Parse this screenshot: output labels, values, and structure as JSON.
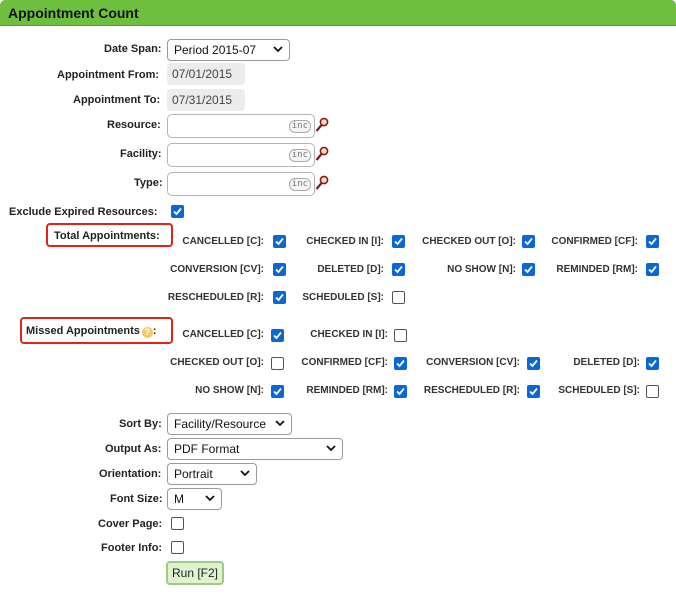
{
  "header": {
    "title": "Appointment Count"
  },
  "form": {
    "date_span": {
      "label": "Date Span:",
      "value": "Period 2015-07"
    },
    "appt_from": {
      "label": "Appointment From:",
      "value": "07/01/2015"
    },
    "appt_to": {
      "label": "Appointment To:",
      "value": "07/31/2015"
    },
    "resource": {
      "label": "Resource:",
      "value": "",
      "tag": "inc"
    },
    "facility": {
      "label": "Facility:",
      "value": "",
      "tag": "inc"
    },
    "type": {
      "label": "Type:",
      "value": "",
      "tag": "inc"
    },
    "exclude_expired": {
      "label": "Exclude Expired Resources:",
      "checked": true
    }
  },
  "total_appointments": {
    "label": "Total Appointments:",
    "options": [
      {
        "label": "CANCELLED [C]:",
        "checked": true
      },
      {
        "label": "CHECKED IN [I]:",
        "checked": true
      },
      {
        "label": "CHECKED OUT [O]:",
        "checked": true
      },
      {
        "label": "CONFIRMED [CF]:",
        "checked": true
      },
      {
        "label": "CONVERSION [CV]:",
        "checked": true
      },
      {
        "label": "DELETED [D]:",
        "checked": true
      },
      {
        "label": "NO SHOW [N]:",
        "checked": true
      },
      {
        "label": "REMINDED [RM]:",
        "checked": true
      },
      {
        "label": "RESCHEDULED [R]:",
        "checked": true
      },
      {
        "label": "SCHEDULED [S]:",
        "checked": false
      }
    ]
  },
  "missed_appointments": {
    "label": "Missed Appointments",
    "options": [
      {
        "label": "CANCELLED [C]:",
        "checked": true
      },
      {
        "label": "CHECKED IN [I]:",
        "checked": false
      },
      {
        "label": "CHECKED OUT [O]:",
        "checked": false
      },
      {
        "label": "CONFIRMED [CF]:",
        "checked": true
      },
      {
        "label": "CONVERSION [CV]:",
        "checked": true
      },
      {
        "label": "DELETED [D]:",
        "checked": true
      },
      {
        "label": "NO SHOW [N]:",
        "checked": true
      },
      {
        "label": "REMINDED [RM]:",
        "checked": true
      },
      {
        "label": "RESCHEDULED [R]:",
        "checked": true
      },
      {
        "label": "SCHEDULED [S]:",
        "checked": false
      }
    ]
  },
  "output": {
    "sort_by": {
      "label": "Sort By:",
      "value": "Facility/Resource"
    },
    "output_as": {
      "label": "Output As:",
      "value": "PDF Format"
    },
    "orientation": {
      "label": "Orientation:",
      "value": "Portrait"
    },
    "font_size": {
      "label": "Font Size:",
      "value": "M"
    },
    "cover_page": {
      "label": "Cover Page:",
      "checked": false
    },
    "footer_info": {
      "label": "Footer Info:",
      "checked": false
    },
    "run_label": "Run [F2]"
  },
  "colors": {
    "header": "#6fbf3f",
    "checkbox": "#0b66d6",
    "highlight": "#e2231a",
    "run_button": "#dff3cf"
  }
}
